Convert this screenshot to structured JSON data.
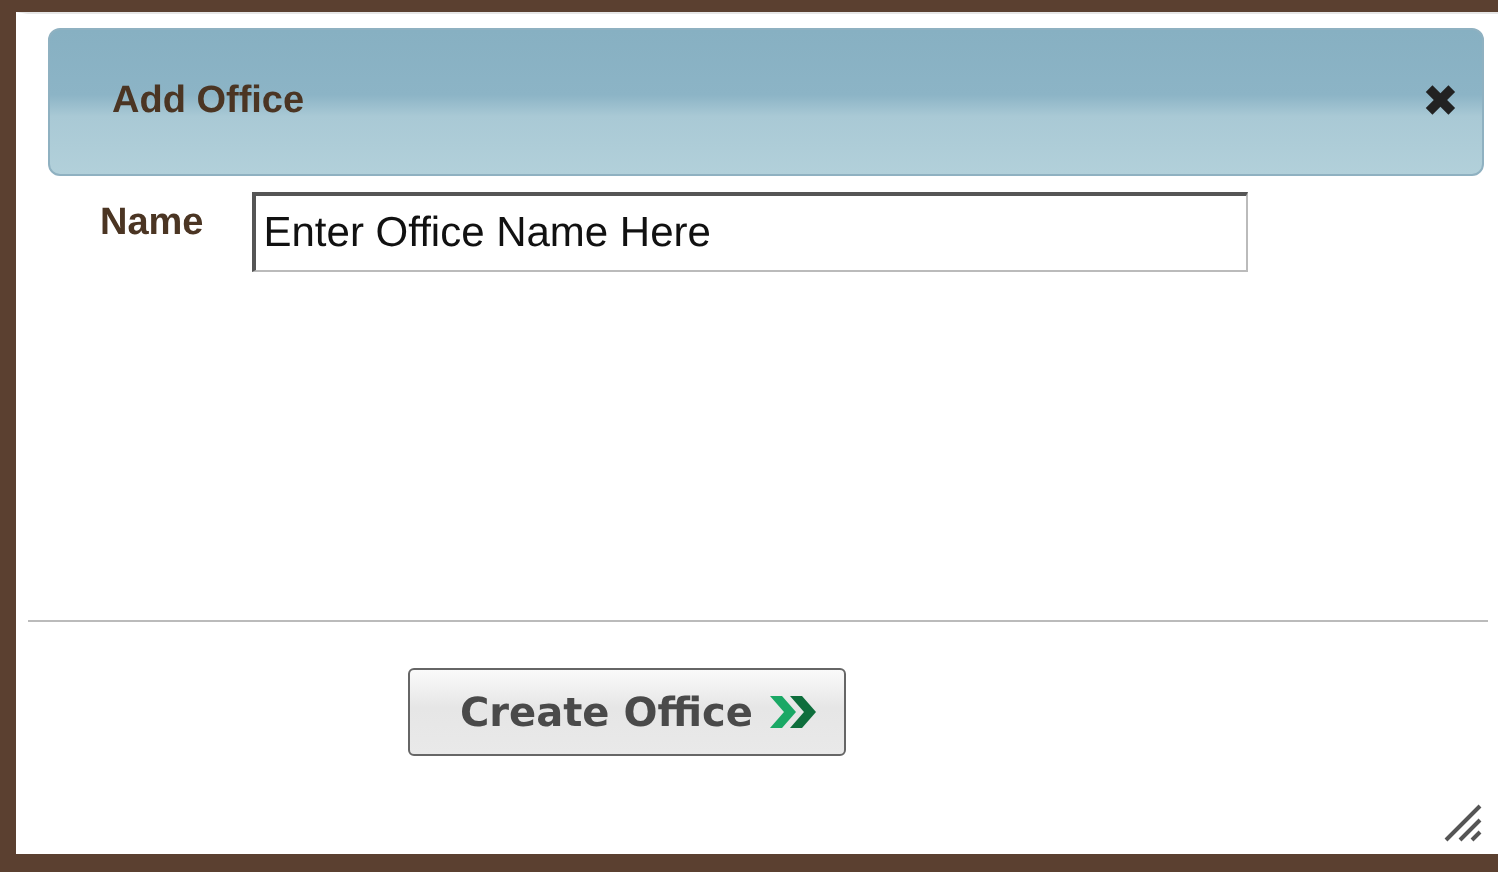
{
  "dialog": {
    "title": "Add Office",
    "close": "✖"
  },
  "fields": [
    {
      "label": "Name",
      "value": "Enter Office Name Here"
    }
  ],
  "buttons": [
    {
      "label": "Create Office"
    }
  ]
}
